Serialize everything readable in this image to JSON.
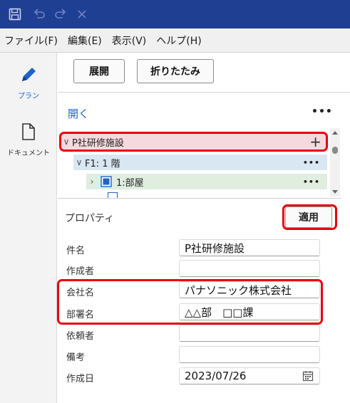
{
  "menu": [
    "ファイル(F)",
    "編集(E)",
    "表示(V)",
    "ヘルプ(H)"
  ],
  "rail": {
    "plan_label": "プラン",
    "document_label": "ドキュメント"
  },
  "toolbar": {
    "expand_label": "展開",
    "collapse_label": "折りたたみ"
  },
  "tree": {
    "open_label": "開く",
    "more_label": "•••",
    "items": [
      {
        "label": "P社研修施設",
        "action": "+"
      },
      {
        "label": "F1: 1 階",
        "action": "•••"
      },
      {
        "label": "1:部屋",
        "action": "•••"
      }
    ]
  },
  "properties": {
    "title": "プロパティ",
    "apply_label": "適用",
    "fields": [
      {
        "label": "件名",
        "value": "P社研修施設"
      },
      {
        "label": "作成者",
        "value": ""
      },
      {
        "label": "会社名",
        "value": "パナソニック株式会社"
      },
      {
        "label": "部署名",
        "value": "△△部　□□課"
      },
      {
        "label": "依頼者",
        "value": ""
      },
      {
        "label": "備考",
        "value": ""
      },
      {
        "label": "作成日",
        "value": "2023/07/26"
      }
    ]
  },
  "colors": {
    "titlebar": "#1f3f93",
    "accent": "#1f63c8",
    "highlight": "#e60012",
    "tree_root_bg": "#f4d9de",
    "tree_floor_bg": "#d9e7f2",
    "tree_room_bg": "#dfeedf"
  }
}
